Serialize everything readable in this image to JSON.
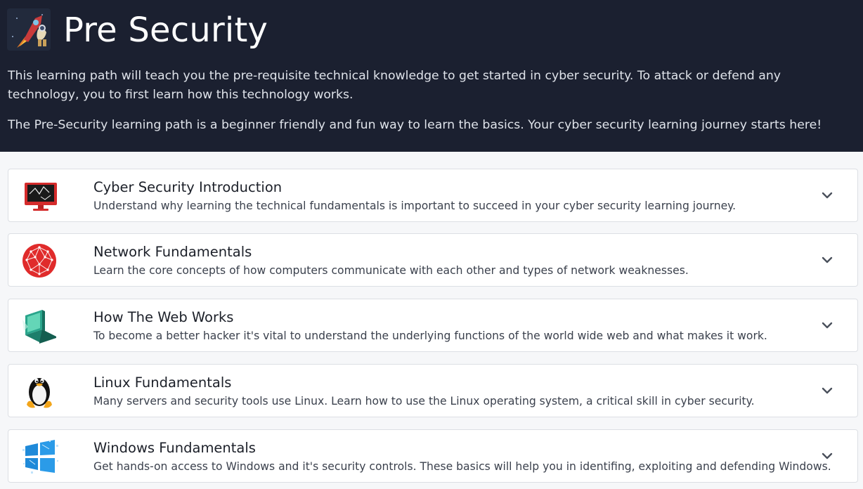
{
  "header": {
    "title": "Pre Security",
    "logo_icon": "rocket-astronaut-icon",
    "description_1": "This learning path will teach you the pre-requisite technical knowledge to get started in cyber security. To attack or defend any technology, you to first learn how this technology works.",
    "description_2": "The Pre-Security learning path is a beginner friendly and fun way to learn the basics. Your cyber security learning journey starts here!"
  },
  "modules": [
    {
      "title": "Cyber Security Introduction",
      "description": "Understand why learning the technical fundamentals is important to succeed in your cyber security learning journey.",
      "icon": "monitor-icon"
    },
    {
      "title": "Network Fundamentals",
      "description": "Learn the core concepts of how computers communicate with each other and types of network weaknesses.",
      "icon": "network-globe-icon"
    },
    {
      "title": "How The Web Works",
      "description": "To become a better hacker it's vital to understand the underlying functions of the world wide web and what makes it work.",
      "icon": "laptop-icon"
    },
    {
      "title": "Linux Fundamentals",
      "description": "Many servers and security tools use Linux. Learn how to use the Linux operating system, a critical skill in cyber security.",
      "icon": "linux-penguin-icon"
    },
    {
      "title": "Windows Fundamentals",
      "description": "Get hands-on access to Windows and it's security controls. These basics will help you in identifing, exploiting and defending Windows.",
      "icon": "windows-logo-icon"
    }
  ],
  "colors": {
    "header_bg": "#1b2030",
    "card_bg": "#ffffff",
    "accent_red": "#e02b2b"
  }
}
